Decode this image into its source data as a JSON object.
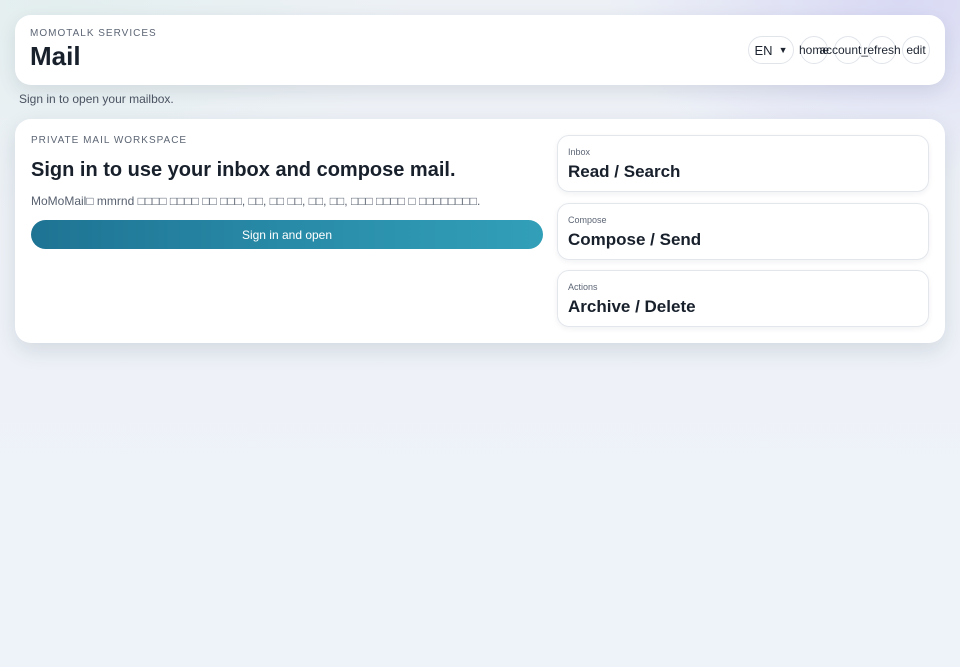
{
  "header": {
    "eyebrow": "MOMOTALK SERVICES",
    "title": "Mail",
    "language": {
      "selected": "EN"
    },
    "icon_buttons": [
      {
        "label": "home"
      },
      {
        "label": "account_ci"
      },
      {
        "label": "refresh"
      },
      {
        "label": "edit"
      }
    ]
  },
  "subtitle": "Sign in to open your mailbox.",
  "main": {
    "section_label": "PRIVATE MAIL WORKSPACE",
    "headline": "Sign in to use your inbox and compose mail.",
    "description": "MoMoMail□ mmrnd □□□□ □□□□ □□ □□□, □□, □□ □□, □□, □□, □□□ □□□□ □ □□□□□□□□.",
    "signin_button": "Sign in and open"
  },
  "features": [
    {
      "kicker": "Inbox",
      "title": "Read / Search"
    },
    {
      "kicker": "Compose",
      "title": "Compose / Send"
    },
    {
      "kicker": "Actions",
      "title": "Archive / Delete"
    }
  ]
}
